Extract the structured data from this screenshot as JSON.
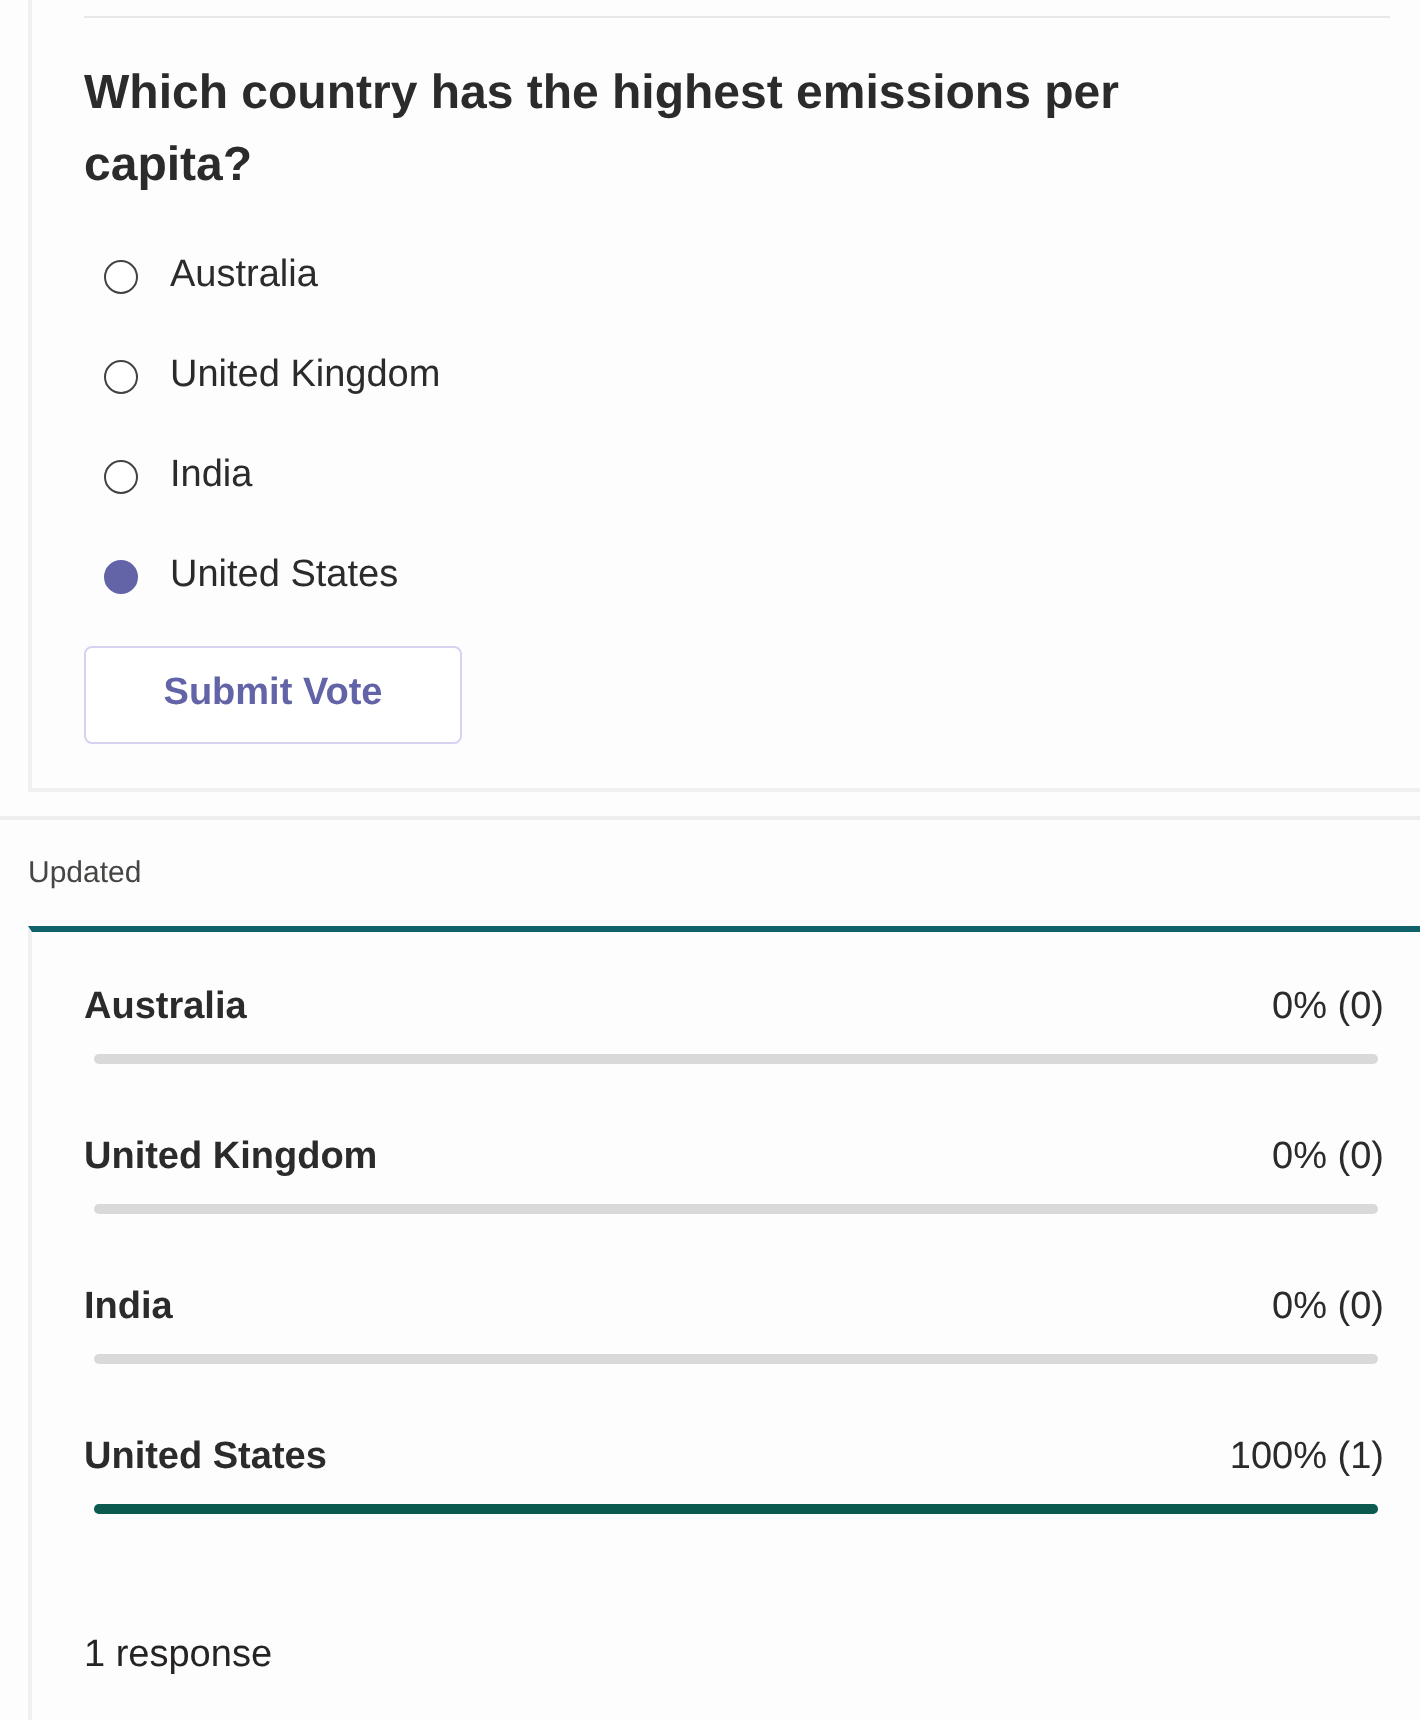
{
  "poll": {
    "question": "Which country has the highest emissions per capita?",
    "options": [
      {
        "label": "Australia",
        "selected": false
      },
      {
        "label": "United Kingdom",
        "selected": false
      },
      {
        "label": "India",
        "selected": false
      },
      {
        "label": "United States",
        "selected": true
      }
    ],
    "submit_button": "Submit Vote"
  },
  "results": {
    "status": "Updated",
    "rows": [
      {
        "label": "Australia",
        "reading": "0% (0)",
        "level": 0
      },
      {
        "label": "United Kingdom",
        "reading": "0% (0)",
        "level": 0
      },
      {
        "label": "India",
        "reading": "0% (0)",
        "level": 0
      },
      {
        "label": "United States",
        "reading": "100% (1)",
        "level": 1
      }
    ],
    "summary": "1 response"
  }
}
